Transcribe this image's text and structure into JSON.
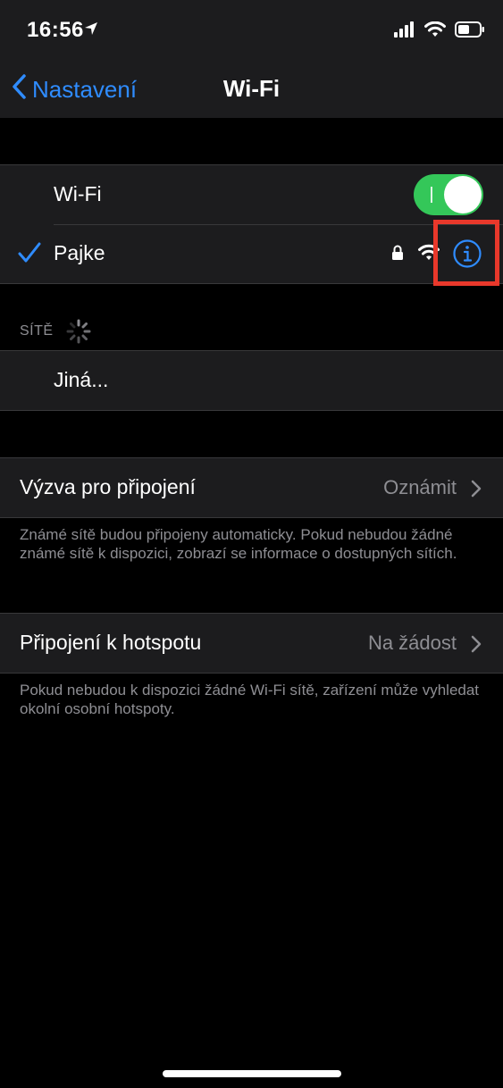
{
  "status_bar": {
    "time": "16:56"
  },
  "nav": {
    "back_label": "Nastavení",
    "title": "Wi-Fi"
  },
  "wifi": {
    "label": "Wi-Fi",
    "enabled": true,
    "connected_network": "Pajke"
  },
  "networks": {
    "header": "SÍTĚ",
    "other_label": "Jiná..."
  },
  "ask_join": {
    "label": "Výzva pro připojení",
    "value": "Oznámit",
    "footer": "Známé sítě budou připojeny automaticky. Pokud nebudou žádné známé sítě k dispozici, zobrazí se informace o dostupných sítích."
  },
  "hotspot": {
    "label": "Připojení k hotspotu",
    "value": "Na žádost",
    "footer": "Pokud nebudou k dispozici žádné Wi-Fi sítě, zařízení může vyhledat okolní osobní hotspoty."
  },
  "colors": {
    "accent": "#2f8cff",
    "toggle_on": "#34c759",
    "highlight": "#e8382b",
    "background": "#000000",
    "cell": "#1c1c1e"
  },
  "icons": {
    "location": "location-arrow-icon",
    "signal": "cellular-signal-icon",
    "wifi": "wifi-icon",
    "battery": "battery-icon",
    "back": "chevron-left-icon",
    "check": "checkmark-icon",
    "lock": "lock-icon",
    "info": "info-icon",
    "spinner": "activity-spinner-icon",
    "chevron": "chevron-right-icon"
  }
}
